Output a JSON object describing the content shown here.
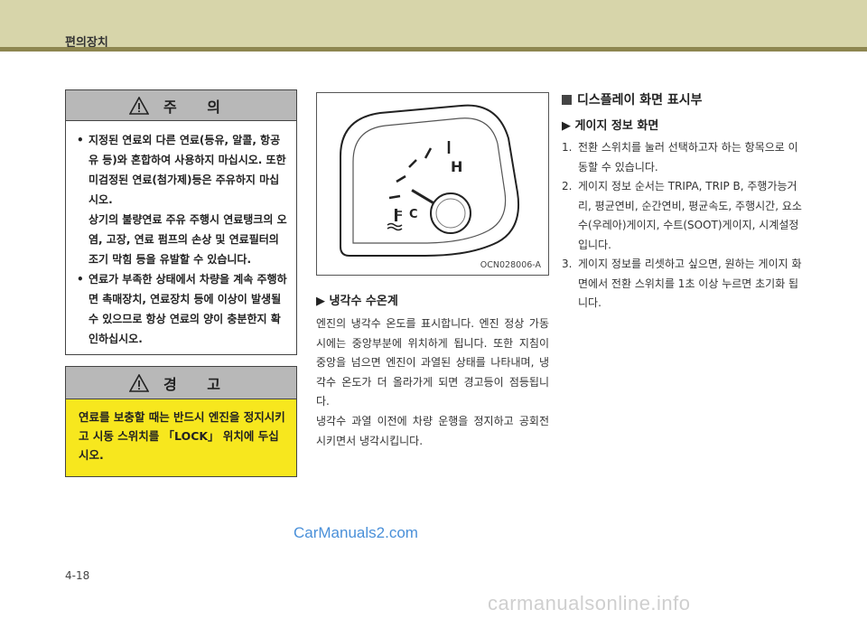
{
  "header": {
    "title": "편의장치"
  },
  "caution": {
    "title": "주  의",
    "items": [
      [
        "지정된 연료외 다른 연료(등유, 알콜, 항공유 등)와 혼합하여 사용하지 마십시오. 또한 미검정된 연료(첨가제)등은 주유하지 마십시오.",
        "상기의 불량연료 주유 주행시 연료탱크의 오염, 고장, 연료 펌프의 손상 및 연료필터의 조기 막힘 등을 유발할 수 있습니다."
      ],
      [
        "연료가 부족한 상태에서 차량을 계속 주행하면 촉매장치, 연료장치 등에 이상이 발생될 수 있으므로 항상 연료의 양이 충분한지 확인하십시오."
      ]
    ]
  },
  "warning": {
    "title": "경  고",
    "text": "연료를 보충할 때는 반드시 엔진을 정지시키고 시동 스위치를 「LOCK」 위치에 두십시오."
  },
  "figure": {
    "code": "OCN028006-A",
    "hot_label": "H",
    "cold_label": "C",
    "level": 0.2
  },
  "coolant": {
    "heading": "▶ 냉각수 수온계",
    "body1": "엔진의 냉각수 온도를 표시합니다. 엔진 정상 가동시에는 중앙부분에 위치하게 됩니다. 또한 지침이 중앙을 넘으면 엔진이 과열된 상태를 나타내며, 냉각수 온도가 더 올라가게 되면 경고등이 점등됩니다.",
    "body2": "냉각수 과열 이전에 차량 운행을 정지하고 공회전 시키면서 냉각시킵니다."
  },
  "display": {
    "heading": "디스플레이 화면 표시부",
    "subheading": "▶ 게이지 정보 화면",
    "items": [
      {
        "num": "1.",
        "text": "전환 스위치를 눌러 선택하고자 하는 항목으로 이동할 수 있습니다."
      },
      {
        "num": "2.",
        "text": "게이지 정보 순서는 TRIPA, TRIP B, 주행가능거리, 평균연비, 순간연비, 평균속도, 주행시간, 요소수(우레아)게이지, 수트(SOOT)게이지, 시계설정입니다."
      },
      {
        "num": "3.",
        "text": "게이지 정보를 리셋하고 싶으면, 원하는 게이지 화면에서 전환 스위치를 1초 이상 누르면 초기화 됩니다."
      }
    ]
  },
  "watermark": "CarManuals2.com",
  "page_number": "4-18",
  "footer_watermark": "carmanualsonline.info"
}
